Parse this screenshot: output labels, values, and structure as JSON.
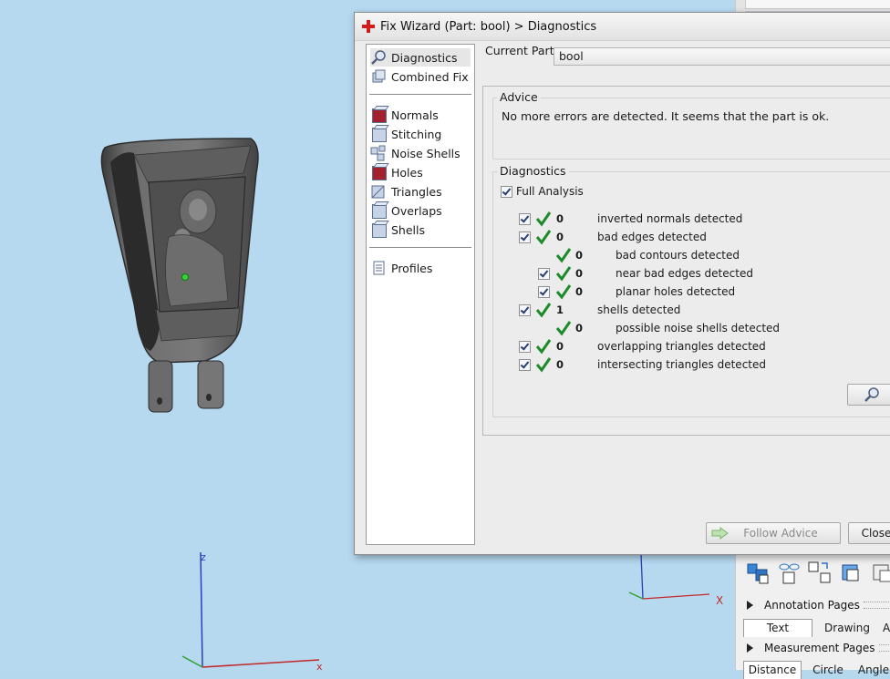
{
  "viewport": {
    "axis_z": "z",
    "axis_x": "x",
    "axis_x2": "X"
  },
  "right_panel": {
    "annotation_pages": "Annotation Pages",
    "measurement_pages": "Measurement Pages",
    "tabs": [
      "Text",
      "Drawing",
      "A"
    ],
    "tabs2": [
      "Distance",
      "Circle",
      "Angle"
    ]
  },
  "dialog": {
    "title": "Fix Wizard (Part: bool) > Diagnostics",
    "nav": {
      "top": [
        {
          "label": "Diagnostics",
          "icon": "magnifier-icon"
        },
        {
          "label": "Combined Fix",
          "icon": "stack-icon"
        }
      ],
      "fixes": [
        {
          "label": "Normals",
          "icon": "normals-cube-icon"
        },
        {
          "label": "Stitching",
          "icon": "stitching-cube-icon"
        },
        {
          "label": "Noise Shells",
          "icon": "noise-shells-icon"
        },
        {
          "label": "Holes",
          "icon": "holes-cube-icon"
        },
        {
          "label": "Triangles",
          "icon": "triangles-cube-icon"
        },
        {
          "label": "Overlaps",
          "icon": "overlaps-cube-icon"
        },
        {
          "label": "Shells",
          "icon": "shells-cube-icon"
        }
      ],
      "bottom": [
        {
          "label": "Profiles",
          "icon": "document-icon"
        }
      ]
    },
    "current_part_label": "Current Part:",
    "current_part_value": "bool",
    "advice_legend": "Advice",
    "advice_text": "No more errors are detected. It seems that the part is ok.",
    "diagnostics_legend": "Diagnostics",
    "full_analysis": "Full Analysis",
    "rows": [
      {
        "count": "0",
        "label": "inverted normals detected"
      },
      {
        "count": "0",
        "label": "bad edges detected"
      },
      {
        "count": "0",
        "label": "bad contours detected"
      },
      {
        "count": "0",
        "label": "near bad edges detected"
      },
      {
        "count": "0",
        "label": "planar holes detected"
      },
      {
        "count": "1",
        "label": "shells detected"
      },
      {
        "count": "0",
        "label": "possible noise shells detected"
      },
      {
        "count": "0",
        "label": "overlapping triangles detected"
      },
      {
        "count": "0",
        "label": "intersecting triangles detected"
      }
    ],
    "follow_advice": "Follow Advice",
    "close": "Close"
  }
}
